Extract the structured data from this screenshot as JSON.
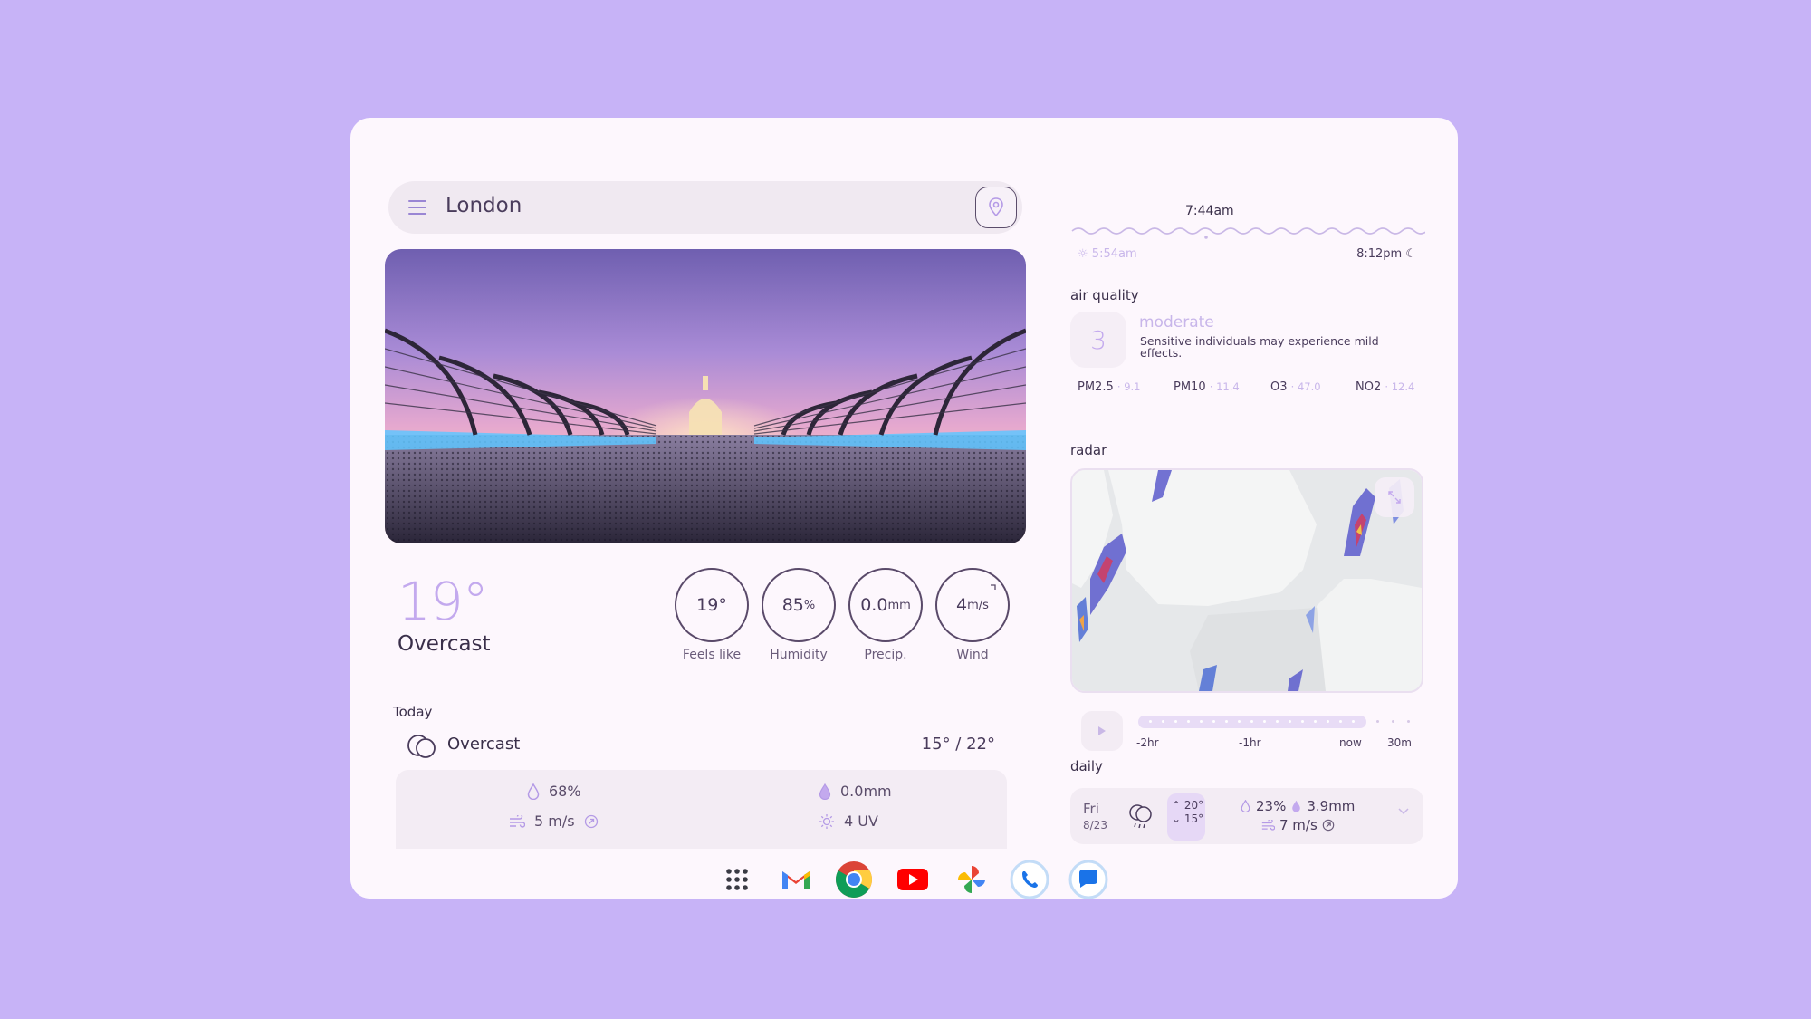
{
  "search": {
    "city": "London"
  },
  "current": {
    "temp": "19°",
    "condition": "Overcast",
    "stats": [
      {
        "value": "19°",
        "unit": "",
        "label": "Feels like"
      },
      {
        "value": "85",
        "unit": "%",
        "label": "Humidity"
      },
      {
        "value": "0.0",
        "unit": "mm",
        "label": "Precip."
      },
      {
        "value": "4",
        "unit": "m/s",
        "label": "Wind"
      }
    ]
  },
  "today": {
    "label": "Today",
    "condition": "Overcast",
    "range": "15° / 22°",
    "humidity": "68%",
    "precip": "0.0mm",
    "wind": "5 m/s",
    "uv": "4 UV"
  },
  "sun": {
    "current_time": "7:44am",
    "sunrise": "5:54am",
    "sunset": "8:12pm"
  },
  "air_quality": {
    "label": "air quality",
    "index": "3",
    "level": "moderate",
    "description": "Sensitive individuals may experience mild effects.",
    "pollutants": [
      {
        "name": "PM2.5",
        "value": "9.1"
      },
      {
        "name": "PM10",
        "value": "11.4"
      },
      {
        "name": "O3",
        "value": "47.0"
      },
      {
        "name": "NO2",
        "value": "12.4"
      }
    ]
  },
  "radar": {
    "label": "radar",
    "timeline_labels": [
      "-2hr",
      "-1hr",
      "now",
      "30m"
    ]
  },
  "daily": {
    "label": "daily",
    "rows": [
      {
        "day": "Fri",
        "date": "8/23",
        "high": "20°",
        "low": "15°",
        "pop": "23%",
        "precip": "3.9mm",
        "wind": "7 m/s"
      }
    ]
  },
  "dock": [
    "apps-icon",
    "gmail-icon",
    "chrome-icon",
    "youtube-icon",
    "photos-icon",
    "phone-icon",
    "messages-icon"
  ],
  "colors": {
    "background": "#c7b3f7",
    "card": "#fdf7fd",
    "accent": "#c3a9ee"
  }
}
